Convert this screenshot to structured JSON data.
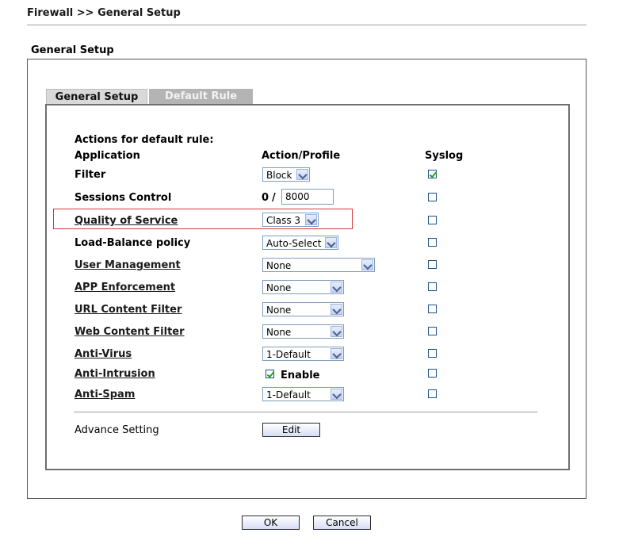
{
  "breadcrumb": "Firewall >> General Setup",
  "section_title": "General Setup",
  "tabs": [
    {
      "label": "General Setup",
      "active": true
    },
    {
      "label": "Default Rule",
      "active": false
    }
  ],
  "table": {
    "intro": "Actions for default rule:",
    "col_application": "Application",
    "col_action": "Action/Profile",
    "col_syslog": "Syslog"
  },
  "rows": {
    "filter": {
      "label": "Filter",
      "value": "Block",
      "syslog": true
    },
    "sessions": {
      "label": "Sessions Control",
      "current": "0",
      "separator": "/",
      "max": "8000",
      "syslog": false
    },
    "qos": {
      "label": "Quality of Service",
      "value": "Class 3",
      "syslog": false
    },
    "load_balance": {
      "label": "Load-Balance policy",
      "value": "Auto-Select",
      "syslog": false
    },
    "user_mgmt": {
      "label": "User Management",
      "value": "None",
      "syslog": false
    },
    "app_enforcement": {
      "label": "APP Enforcement",
      "value": "None",
      "syslog": false
    },
    "url_filter": {
      "label": "URL Content Filter",
      "value": "None",
      "syslog": false
    },
    "web_filter": {
      "label": "Web Content Filter",
      "value": "None",
      "syslog": false
    },
    "anti_virus": {
      "label": "Anti-Virus",
      "value": "1-Default",
      "syslog": false
    },
    "anti_intrusion": {
      "label": "Anti-Intrusion",
      "enable_label": "Enable",
      "enabled": true,
      "syslog": false
    },
    "anti_spam": {
      "label": "Anti-Spam",
      "value": "1-Default",
      "syslog": false
    }
  },
  "advance": {
    "label": "Advance Setting",
    "button": "Edit"
  },
  "footer": {
    "ok": "OK",
    "cancel": "Cancel"
  },
  "colors": {
    "highlight": "#d23b3b",
    "checkmark": "#21a121",
    "tab_inactive": "#b4b4b4"
  }
}
